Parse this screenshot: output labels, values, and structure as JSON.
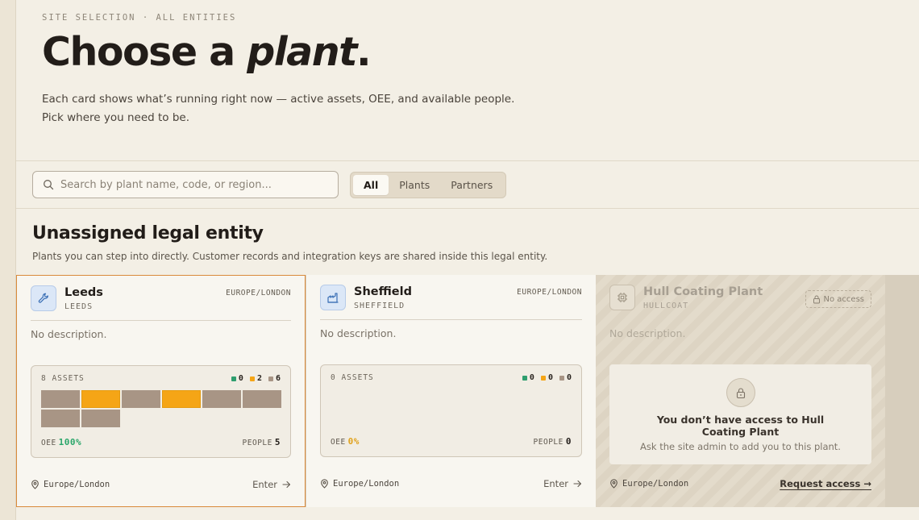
{
  "hero": {
    "eyebrow": "SITE SELECTION · ALL ENTITIES",
    "title_plain": "Choose a ",
    "title_italic": "plant",
    "title_end": ".",
    "lede_line1": "Each card shows what’s running right now — active assets, OEE, and available people.",
    "lede_line2": "Pick where you need to be."
  },
  "search": {
    "placeholder": "Search by plant name, code, or region..."
  },
  "filters": {
    "all": "All",
    "plants": "Plants",
    "partners": "Partners",
    "selected": "All"
  },
  "section": {
    "title": "Unassigned legal entity",
    "subtitle": "Plants you can step into directly. Customer records and integration keys are shared inside this legal entity."
  },
  "colors": {
    "running": "#2f9e6e",
    "idle": "#f5a516",
    "offline": "#a89585",
    "oee_good": "#2aa66a",
    "oee_zero": "#e0a21c"
  },
  "cards": [
    {
      "name": "Leeds",
      "code": "LEEDS",
      "timezone": "EUROPE/LONDON",
      "icon": "wrench-icon",
      "description": "No description.",
      "assets_label": "8 ASSETS",
      "legend": {
        "running": "0",
        "idle": "2",
        "offline": "6"
      },
      "tiles": [
        "offline",
        "idle",
        "offline",
        "idle",
        "offline",
        "offline",
        "offline",
        "offline"
      ],
      "oee_label": "OEE",
      "oee_value": "100%",
      "people_label": "PEOPLE",
      "people_value": "5",
      "location": "Europe/London",
      "action": "Enter"
    },
    {
      "name": "Sheffield",
      "code": "SHEFFIELD",
      "timezone": "EUROPE/LONDON",
      "icon": "factory-icon",
      "description": "No description.",
      "assets_label": "0 ASSETS",
      "legend": {
        "running": "0",
        "idle": "0",
        "offline": "0"
      },
      "tiles": [],
      "oee_label": "OEE",
      "oee_value": "0%",
      "people_label": "PEOPLE",
      "people_value": "0",
      "location": "Europe/London",
      "action": "Enter"
    },
    {
      "name": "Hull Coating Plant",
      "code": "HULLCOAT",
      "badge": "No access",
      "icon": "chip-icon",
      "description": "No description.",
      "locked_title": "You don’t have access to Hull Coating Plant",
      "locked_sub": "Ask the site admin to add you to this plant.",
      "location": "Europe/London",
      "action": "Request access →"
    }
  ]
}
